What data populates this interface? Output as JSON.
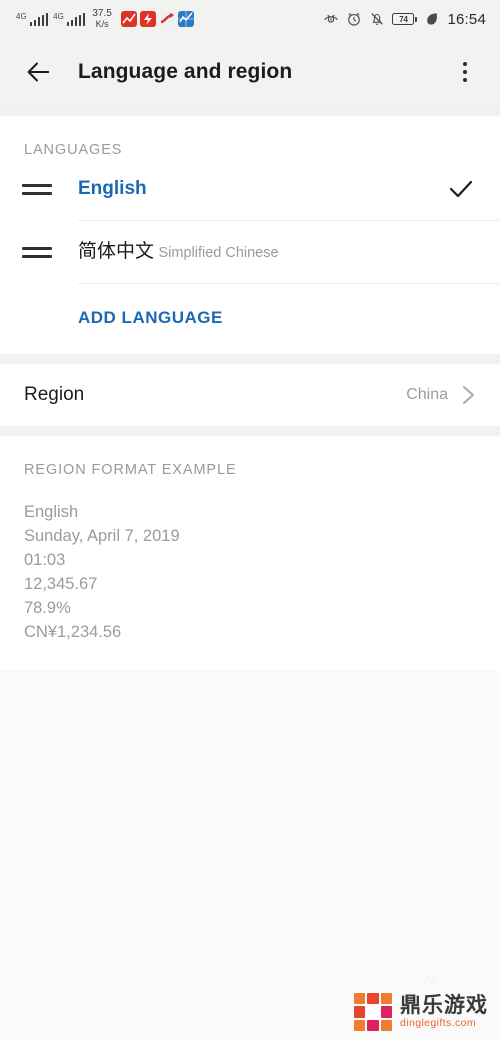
{
  "statusbar": {
    "signal_1_label": "4G",
    "signal_2_label": "4G",
    "net_speed_value": "37.5",
    "net_speed_unit": "K/s",
    "battery_percent": "74",
    "time": "16:54",
    "icons": [
      "eye-icon",
      "alarm-icon",
      "bell-muted-icon",
      "battery-icon",
      "leaf-icon"
    ],
    "app_icons": [
      "stock-app-red-icon",
      "stock-app-red2-icon",
      "stock-app-red3-icon",
      "stock-app-blue-icon"
    ]
  },
  "appbar": {
    "back_label": "Back",
    "title": "Language and region",
    "menu_label": "More options"
  },
  "languages_section": {
    "header": "LANGUAGES",
    "items": [
      {
        "name": "English",
        "subtitle": "",
        "selected": true
      },
      {
        "name": "简体中文",
        "subtitle": "Simplified Chinese",
        "selected": false
      }
    ],
    "add_language_label": "ADD LANGUAGE"
  },
  "region_section": {
    "label": "Region",
    "value": "China"
  },
  "format_section": {
    "header": "REGION FORMAT EXAMPLE",
    "lines": [
      "English",
      "Sunday, April 7, 2019",
      "01:03",
      "12,345.67",
      "78.9%",
      "CN¥1,234.56"
    ]
  },
  "watermark": {
    "cn_text": "鼎乐游戏",
    "site": "dinglegifts.com"
  },
  "colors": {
    "accent_blue": "#1b68b3",
    "text_primary": "#1c1c1c",
    "text_secondary": "#9b9b9b",
    "bar_bg": "#f2f2f0",
    "section_bg": "#ffffff",
    "gap_bg": "#f1f1f1"
  }
}
